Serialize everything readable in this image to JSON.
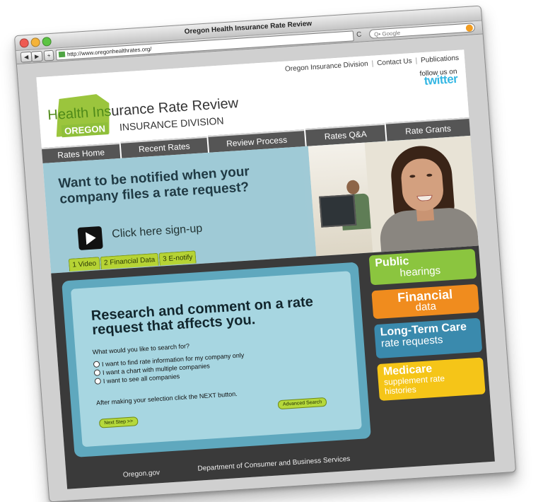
{
  "browser": {
    "window_title": "Oregon Health Insurance Rate Review",
    "url": "http://www.oregonhealthrates.org/",
    "search_placeholder": "Google",
    "search_prefix": "Q•",
    "back_label": "◀",
    "forward_label": "▶",
    "add_label": "+",
    "reload_label": "C"
  },
  "header": {
    "links": [
      "Oregon Insurance Division",
      "Contact Us",
      "Publications"
    ],
    "link_separator": "|",
    "follow_label": "follow us on",
    "twitter_label": "twitter",
    "title_prefix": "Health Ins",
    "title_rest": "urance Rate Review",
    "oregon_label": "OREGON",
    "division_label": "INSURANCE DIVISION"
  },
  "nav": [
    "Rates Home",
    "Recent Rates",
    "Review Process",
    "Rates Q&A",
    "Rate Grants"
  ],
  "hero": {
    "headline": "Want to be notified when your company files a rate request?",
    "signup_label": "Click here sign-up",
    "tabs": [
      "1 Video",
      "2 Financial Data",
      "3 E-notify"
    ]
  },
  "search_panel": {
    "headline": "Research and comment on a rate request that affects you.",
    "question": "What would you like to search for?",
    "options": [
      "I want to find rate information for my company only",
      "I want a chart with multiple companies",
      "I want to see all companies"
    ],
    "instruction": "After making your selection click the NEXT button.",
    "next_button": "Next Step >>",
    "advanced_button": "Advanced Search"
  },
  "sidebar": [
    {
      "top": "Public",
      "bottom": "hearings",
      "bg": "#8bc53f",
      "color": "#ffffff"
    },
    {
      "top": "Financial",
      "bottom": "data",
      "bg": "#f08c1e",
      "color": "#ffffff"
    },
    {
      "top": "Long-Term Care",
      "bottom": "rate requests",
      "bg": "#3a8aad",
      "color": "#ffffff"
    },
    {
      "top": "Medicare",
      "bottom": "supplement rate histories",
      "bg": "#f5c518",
      "color": "#ffffff"
    }
  ],
  "footer": {
    "left": "Oregon.gov",
    "right": "Department of Consumer and Business Services"
  },
  "colors": {
    "accent_green": "#8fbf3a",
    "nav_gray": "#555555",
    "panel_blue": "#5fa8be",
    "twitter_blue": "#35b7e3"
  }
}
